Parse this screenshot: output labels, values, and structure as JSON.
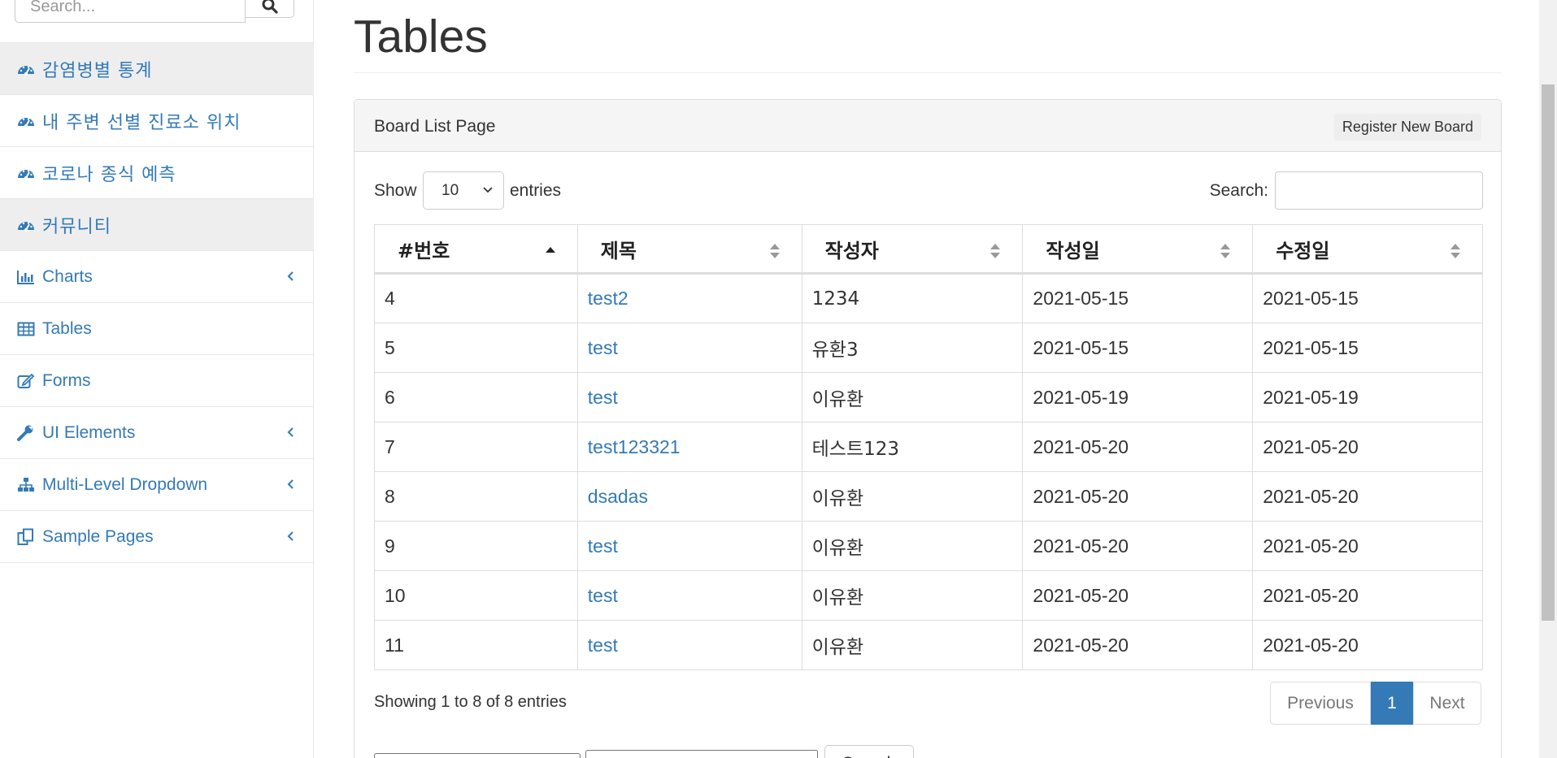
{
  "sidebar": {
    "search_placeholder": "Search...",
    "items": [
      {
        "label": "감염병별 통계",
        "icon": "dashboard-icon",
        "active": true
      },
      {
        "label": "내 주변 선별 진료소 위치",
        "icon": "dashboard-icon"
      },
      {
        "label": "코로나 종식 예측",
        "icon": "dashboard-icon"
      },
      {
        "label": "커뮤니티",
        "icon": "dashboard-icon",
        "active": true
      },
      {
        "label": "Charts",
        "icon": "bar-chart-icon",
        "has_submenu": true
      },
      {
        "label": "Tables",
        "icon": "table-icon"
      },
      {
        "label": "Forms",
        "icon": "edit-icon"
      },
      {
        "label": "UI Elements",
        "icon": "wrench-icon",
        "has_submenu": true
      },
      {
        "label": "Multi-Level Dropdown",
        "icon": "sitemap-icon",
        "has_submenu": true
      },
      {
        "label": "Sample Pages",
        "icon": "files-icon",
        "has_submenu": true
      }
    ]
  },
  "page": {
    "title": "Tables"
  },
  "panel": {
    "title": "Board List Page",
    "register_label": "Register New Board"
  },
  "table_controls": {
    "show_label": "Show",
    "page_length": "10",
    "entries_label": "entries",
    "search_label": "Search:"
  },
  "table": {
    "columns": [
      "#번호",
      "제목",
      "작성자",
      "작성일",
      "수정일"
    ],
    "rows": [
      {
        "no": "4",
        "title": "test2",
        "writer": "1234",
        "created": "2021-05-15",
        "updated": "2021-05-15"
      },
      {
        "no": "5",
        "title": "test",
        "writer": "유환3",
        "created": "2021-05-15",
        "updated": "2021-05-15"
      },
      {
        "no": "6",
        "title": "test",
        "writer": "이유환",
        "created": "2021-05-19",
        "updated": "2021-05-19"
      },
      {
        "no": "7",
        "title": "test123321",
        "writer": "테스트123",
        "created": "2021-05-20",
        "updated": "2021-05-20"
      },
      {
        "no": "8",
        "title": "dsadas",
        "writer": "이유환",
        "created": "2021-05-20",
        "updated": "2021-05-20"
      },
      {
        "no": "9",
        "title": "test",
        "writer": "이유환",
        "created": "2021-05-20",
        "updated": "2021-05-20"
      },
      {
        "no": "10",
        "title": "test",
        "writer": "이유환",
        "created": "2021-05-20",
        "updated": "2021-05-20"
      },
      {
        "no": "11",
        "title": "test",
        "writer": "이유환",
        "created": "2021-05-20",
        "updated": "2021-05-20"
      }
    ]
  },
  "footer": {
    "info": "Showing 1 to 8 of 8 entries",
    "prev_label": "Previous",
    "current_page": "1",
    "next_label": "Next"
  },
  "search_form": {
    "type_value": "--",
    "search_label": "Search"
  },
  "colors": {
    "link": "#337ab7",
    "active_page_bg": "#337ab7",
    "panel_heading_bg": "#f5f5f5",
    "active_nav_bg": "#eeeeee"
  }
}
